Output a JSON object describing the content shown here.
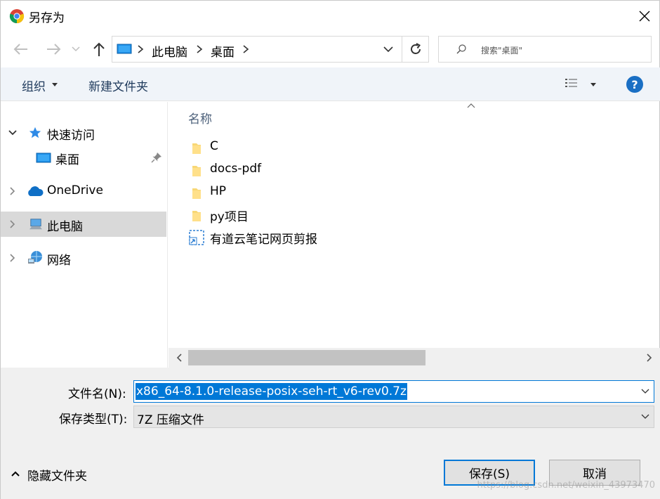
{
  "window": {
    "title": "另存为"
  },
  "address": {
    "crumbs": [
      "此电脑",
      "桌面"
    ]
  },
  "search": {
    "placeholder": "搜索\"桌面\""
  },
  "toolbar": {
    "organize_label": "组织",
    "new_folder_label": "新建文件夹",
    "help_label": "?"
  },
  "nav_pane": {
    "items": [
      {
        "label": "快速访问",
        "expanded": true,
        "icon": "star-icon"
      },
      {
        "label": "桌面",
        "icon": "desktop-icon",
        "pinned": true
      },
      {
        "label": "OneDrive",
        "icon": "cloud-icon"
      },
      {
        "label": "此电脑",
        "icon": "computer-icon",
        "selected": true
      },
      {
        "label": "网络",
        "icon": "network-icon"
      }
    ]
  },
  "file_list": {
    "column_header": "名称",
    "items": [
      {
        "name": "C",
        "icon": "folder-icon"
      },
      {
        "name": "docs-pdf",
        "icon": "folder-icon"
      },
      {
        "name": "HP",
        "icon": "folder-icon"
      },
      {
        "name": "py项目",
        "icon": "folder-icon"
      },
      {
        "name": "有道云笔记网页剪报",
        "icon": "shortcut-icon"
      }
    ]
  },
  "form": {
    "filename_label": "文件名(N):",
    "filename_value": "x86_64-8.1.0-release-posix-seh-rt_v6-rev0.7z",
    "filetype_label": "保存类型(T):",
    "filetype_value": "7Z 压缩文件"
  },
  "footer": {
    "hide_folders_label": "隐藏文件夹",
    "save_label": "保存(S)",
    "cancel_label": "取消",
    "watermark": "https://blog.csdn.net/weixin_43973470"
  },
  "colors": {
    "accent": "#0078d7",
    "selection": "#d9d9d9",
    "toolbar_bg": "#f0f4f9"
  }
}
